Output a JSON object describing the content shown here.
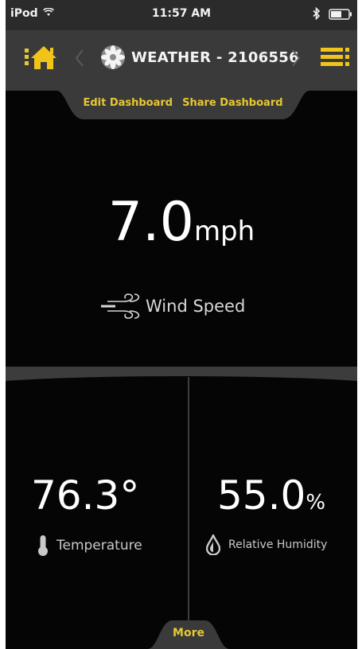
{
  "status_bar": {
    "carrier": "iPod",
    "time": "11:57 AM"
  },
  "nav": {
    "title": "WEATHER - 2106556",
    "icons": {
      "home": "home-icon",
      "prev": "chevron-left-icon",
      "next": "chevron-right-icon",
      "device": "fan-icon",
      "menu": "menu-icon"
    }
  },
  "dashboard": {
    "edit_label": "Edit Dashboard",
    "share_label": "Share Dashboard"
  },
  "wind": {
    "value": "7.0",
    "unit": "mph",
    "label": "Wind Speed",
    "icon": "wind-icon"
  },
  "temperature": {
    "value": "76.3°",
    "label": "Temperature",
    "icon": "thermometer-icon"
  },
  "humidity": {
    "value": "55.0",
    "unit": "%",
    "label": "Relative Humidity",
    "icon": "droplet-icon"
  },
  "more_label": "More",
  "colors": {
    "accent": "#e6c832",
    "background": "#050505",
    "nav_bar": "#3a3a3a",
    "status_bar": "#2b2b2b"
  }
}
